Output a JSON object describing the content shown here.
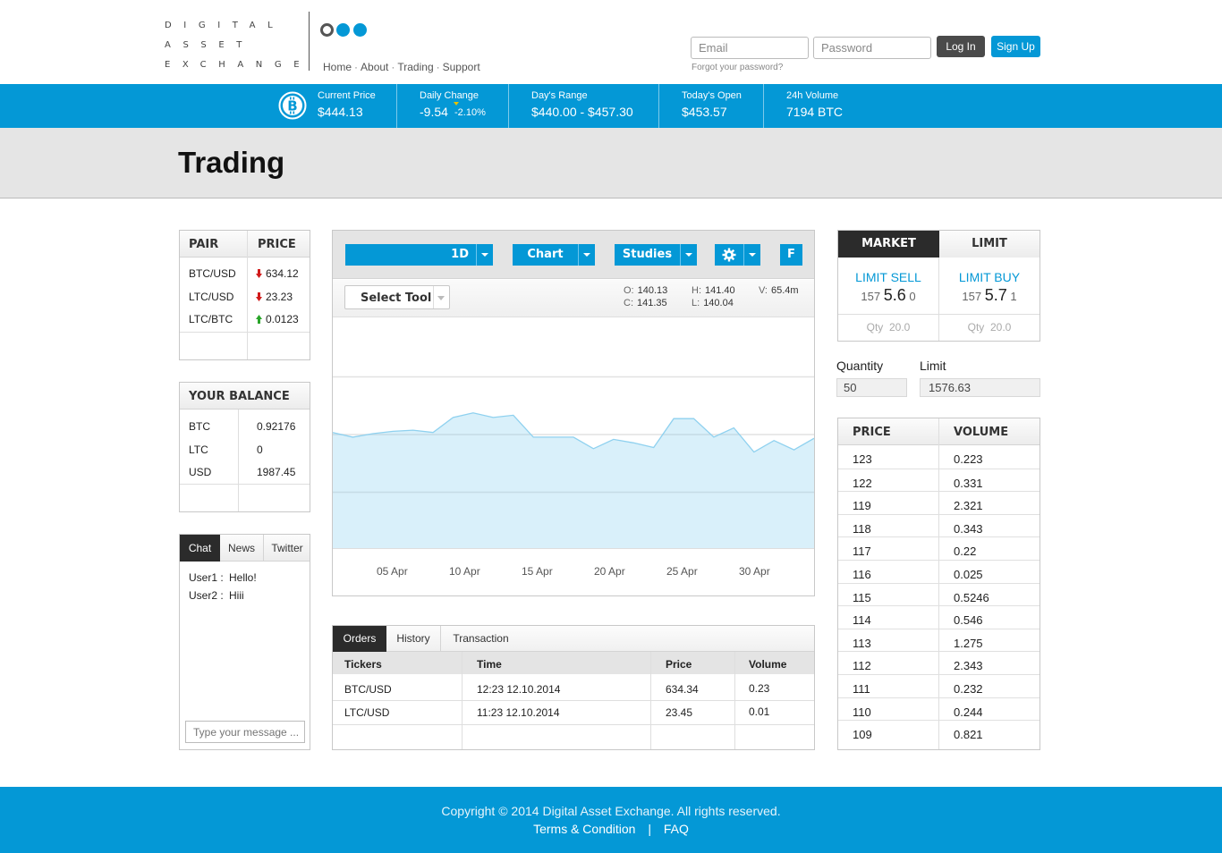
{
  "header": {
    "logo_lines": [
      "DIGITAL",
      "ASSET",
      "EXCHANGE"
    ],
    "nav": [
      "Home",
      "About",
      "Trading",
      "Support"
    ],
    "email_placeholder": "Email",
    "password_placeholder": "Password",
    "login_label": "Log In",
    "signup_label": "Sign Up",
    "forgot": "Forgot your password?"
  },
  "colors": {
    "accent": "#0498d6",
    "dark": "#2b2b2b",
    "up": "#2aa52a",
    "down": "#d11a1a"
  },
  "ticker": {
    "icon": "bitcoin-icon",
    "items": [
      {
        "label": "Current Price",
        "value": "$444.13"
      },
      {
        "label": "Daily Change",
        "value": "-9.54",
        "sub": "-2.10%"
      },
      {
        "label": "Day's Range",
        "value": "$440.00 - $457.30"
      },
      {
        "label": "Today's Open",
        "value": "$453.57"
      },
      {
        "label": "24h Volume",
        "value": "7194 BTC"
      }
    ]
  },
  "page_title": "Trading",
  "pairs": {
    "headers": [
      "PAIR",
      "PRICE"
    ],
    "rows": [
      {
        "pair": "BTC/USD",
        "price": "634.12",
        "dir": "down"
      },
      {
        "pair": "LTC/USD",
        "price": "23.23",
        "dir": "down"
      },
      {
        "pair": "LTC/BTC",
        "price": "0.0123",
        "dir": "up"
      }
    ]
  },
  "balance": {
    "title": "YOUR BALANCE",
    "rows": [
      {
        "cur": "BTC",
        "amt": "0.92176"
      },
      {
        "cur": "LTC",
        "amt": "0"
      },
      {
        "cur": "USD",
        "amt": "1987.45"
      }
    ]
  },
  "chat": {
    "tabs": [
      "Chat",
      "News",
      "Twitter"
    ],
    "messages": [
      {
        "user": "User1 :",
        "text": "Hello!"
      },
      {
        "user": "User2 :",
        "text": "Hiii"
      }
    ],
    "placeholder": "Type your message ..."
  },
  "chart_toolbar": {
    "interval": "1D",
    "chart_label": "Chart",
    "studies_label": "Studies",
    "f_label": "F",
    "select_tool": "Select Tool",
    "ohlc": {
      "O": "140.13",
      "H": "141.40",
      "V": "65.4m",
      "C": "141.35",
      "L": "140.04"
    }
  },
  "chart_data": {
    "type": "area",
    "x": [
      "05 Apr",
      "10 Apr",
      "15 Apr",
      "20 Apr",
      "25 Apr",
      "30 Apr"
    ],
    "values": [
      101,
      97,
      100,
      102,
      103,
      101,
      114,
      118,
      114,
      116,
      97,
      97,
      97,
      87,
      95,
      92,
      88,
      113,
      113,
      97,
      105,
      84,
      94,
      86,
      96
    ],
    "ylim": [
      0,
      200
    ],
    "grid": true
  },
  "orders": {
    "tabs": [
      "Orders",
      "History",
      "Transaction"
    ],
    "headers": [
      "Tickers",
      "Time",
      "Price",
      "Volume"
    ],
    "rows": [
      {
        "ticker": "BTC/USD",
        "time": "12:23 12.10.2014",
        "price": "634.34",
        "volume": "0.23"
      },
      {
        "ticker": "LTC/USD",
        "time": "11:23 12.10.2014",
        "price": "23.45",
        "volume": "0.01"
      }
    ]
  },
  "order_form": {
    "tabs": [
      "MARKET",
      "LIMIT"
    ],
    "sell": {
      "title": "LIMIT SELL",
      "pre": "157",
      "big": "5.6",
      "post": "0",
      "qty_label": "Qty",
      "qty": "20.0"
    },
    "buy": {
      "title": "LIMIT BUY",
      "pre": "157",
      "big": "5.7",
      "post": "1",
      "qty_label": "Qty",
      "qty": "20.0"
    },
    "quantity_label": "Quantity",
    "quantity_value": "50",
    "limit_label": "Limit",
    "limit_value": "1576.63"
  },
  "order_book": {
    "headers": [
      "PRICE",
      "VOLUME"
    ],
    "rows": [
      {
        "price": "123",
        "volume": "0.223"
      },
      {
        "price": "122",
        "volume": "0.331"
      },
      {
        "price": "119",
        "volume": "2.321"
      },
      {
        "price": "118",
        "volume": "0.343"
      },
      {
        "price": "117",
        "volume": "0.22"
      },
      {
        "price": "116",
        "volume": "0.025"
      },
      {
        "price": "115",
        "volume": "0.5246"
      },
      {
        "price": "114",
        "volume": "0.546"
      },
      {
        "price": "113",
        "volume": "1.275"
      },
      {
        "price": "112",
        "volume": "2.343"
      },
      {
        "price": "111",
        "volume": "0.232"
      },
      {
        "price": "110",
        "volume": "0.244"
      },
      {
        "price": "109",
        "volume": "0.821"
      }
    ]
  },
  "footer": {
    "copyright": "Copyright © 2014 Digital Asset Exchange. All rights reserved.",
    "links": [
      "Terms & Condition",
      "FAQ"
    ],
    "separator": "|"
  }
}
